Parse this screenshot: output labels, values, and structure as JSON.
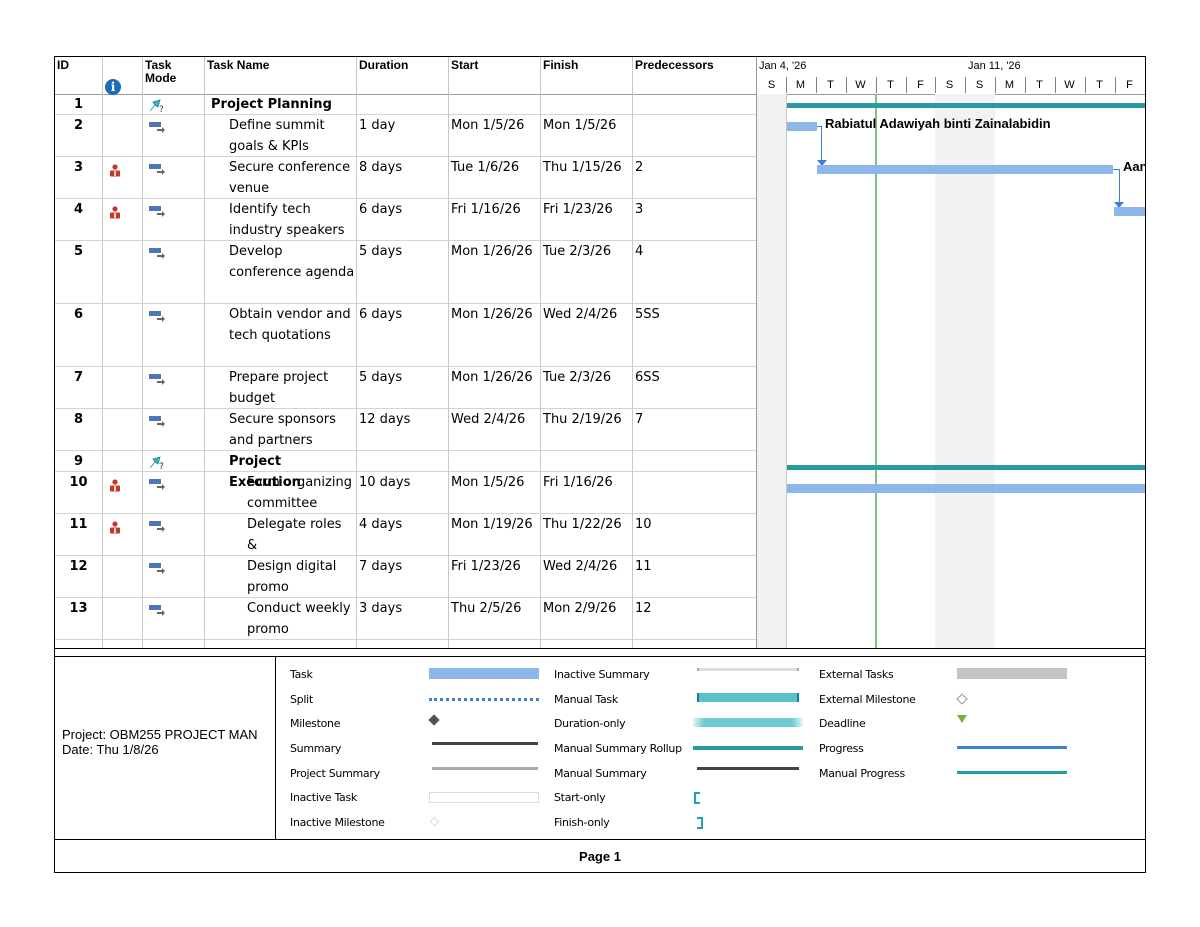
{
  "table": {
    "headers": {
      "id": "ID",
      "task_mode": "Task Mode",
      "task_name": "Task Name",
      "duration": "Duration",
      "start": "Start",
      "finish": "Finish",
      "predecessors": "Predecessors"
    },
    "rows": [
      {
        "id": "1",
        "name": "Project Planning",
        "duration": "",
        "start": "",
        "finish": "",
        "pred": "",
        "level": 0,
        "summary": true,
        "resource": false
      },
      {
        "id": "2",
        "name": "Define summit goals & KPIs",
        "duration": "1 day",
        "start": "Mon 1/5/26",
        "finish": "Mon 1/5/26",
        "pred": "",
        "level": 1,
        "summary": false,
        "resource": false
      },
      {
        "id": "3",
        "name": "Secure conference venue",
        "duration": "8 days",
        "start": "Tue 1/6/26",
        "finish": "Thu 1/15/26",
        "pred": "2",
        "level": 1,
        "summary": false,
        "resource": true
      },
      {
        "id": "4",
        "name": "Identify tech industry speakers",
        "duration": "6 days",
        "start": "Fri 1/16/26",
        "finish": "Fri 1/23/26",
        "pred": "3",
        "level": 1,
        "summary": false,
        "resource": true
      },
      {
        "id": "5",
        "name": "Develop conference agenda",
        "duration": "5 days",
        "start": "Mon 1/26/26",
        "finish": "Tue 2/3/26",
        "pred": "4",
        "level": 1,
        "summary": false,
        "resource": false
      },
      {
        "id": "6",
        "name": "Obtain vendor and tech quotations",
        "duration": "6 days",
        "start": "Mon 1/26/26",
        "finish": "Wed 2/4/26",
        "pred": "5SS",
        "level": 1,
        "summary": false,
        "resource": false
      },
      {
        "id": "7",
        "name": "Prepare project budget",
        "duration": "5 days",
        "start": "Mon 1/26/26",
        "finish": "Tue 2/3/26",
        "pred": "6SS",
        "level": 1,
        "summary": false,
        "resource": false
      },
      {
        "id": "8",
        "name": "Secure sponsors and partners",
        "duration": "12 days",
        "start": "Wed 2/4/26",
        "finish": "Thu 2/19/26",
        "pred": "7",
        "level": 1,
        "summary": false,
        "resource": false
      },
      {
        "id": "9",
        "name": "Project Execution",
        "duration": "",
        "start": "",
        "finish": "",
        "pred": "",
        "level": 1,
        "summary": true,
        "resource": false
      },
      {
        "id": "10",
        "name": "Form organizing committee",
        "duration": "10 days",
        "start": "Mon 1/5/26",
        "finish": "Fri 1/16/26",
        "pred": "",
        "level": 2,
        "summary": false,
        "resource": true
      },
      {
        "id": "11",
        "name": "Delegate roles &",
        "duration": "4 days",
        "start": "Mon 1/19/26",
        "finish": "Thu 1/22/26",
        "pred": "10",
        "level": 2,
        "summary": false,
        "resource": true
      },
      {
        "id": "12",
        "name": "Design digital promo",
        "duration": "7 days",
        "start": "Fri 1/23/26",
        "finish": "Wed 2/4/26",
        "pred": "11",
        "level": 2,
        "summary": false,
        "resource": false
      },
      {
        "id": "13",
        "name": "Conduct weekly promo",
        "duration": "3 days",
        "start": "Thu 2/5/26",
        "finish": "Mon 2/9/26",
        "pred": "12",
        "level": 2,
        "summary": false,
        "resource": false
      }
    ]
  },
  "timeline": {
    "weeks": [
      "Jan 4, '26",
      "Jan 11, '26"
    ],
    "days": [
      "S",
      "M",
      "T",
      "W",
      "T",
      "F",
      "S",
      "S",
      "M",
      "T",
      "W",
      "T",
      "F"
    ],
    "labels": [
      "Rabiatul Adawiyah binti Zainalabidin",
      "Aan"
    ]
  },
  "legend": {
    "col1": [
      "Task",
      "Split",
      "Milestone",
      "Summary",
      "Project Summary",
      "Inactive Task",
      "Inactive Milestone"
    ],
    "col2": [
      "Inactive Summary",
      "Manual Task",
      "Duration-only",
      "Manual Summary Rollup",
      "Manual Summary",
      "Start-only",
      "Finish-only"
    ],
    "col3": [
      "External Tasks",
      "External Milestone",
      "Deadline",
      "Progress",
      "Manual Progress"
    ]
  },
  "project": {
    "name": "Project: OBM255 PROJECT MAN",
    "date": "Date: Thu 1/8/26"
  },
  "footer": {
    "page": "Page 1"
  },
  "colors": {
    "task": "#8db7e8",
    "summary": "#2a9aa2",
    "progress": "#3d7fd1",
    "today": "#7dc67d",
    "resource_icon": "#c0392b"
  }
}
